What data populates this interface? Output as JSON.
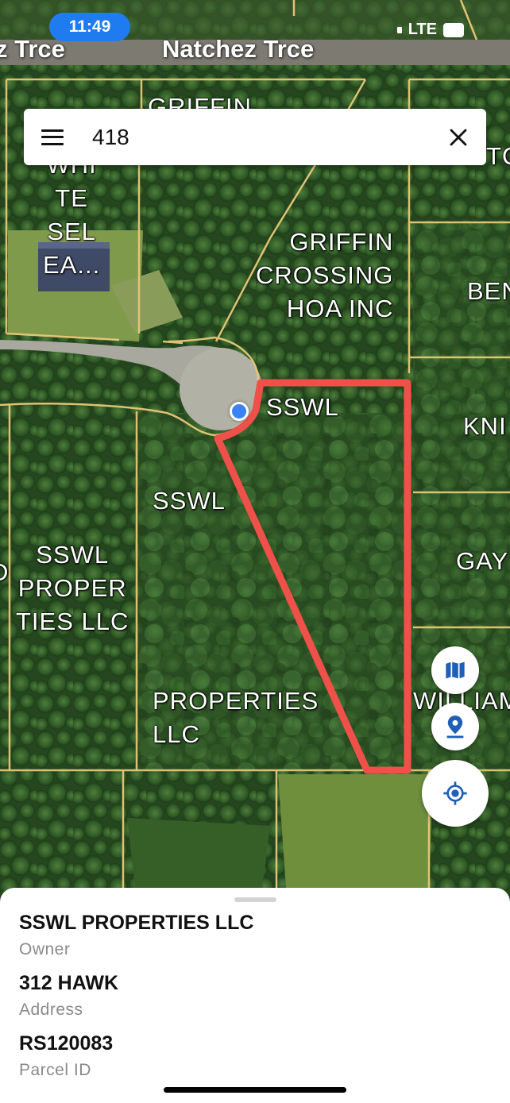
{
  "status_bar": {
    "time": "11:49",
    "network": "LTE"
  },
  "map": {
    "roads": [
      {
        "id": "natchez-left",
        "label": "z Trce"
      },
      {
        "id": "natchez-main",
        "label": "Natchez Trce"
      }
    ],
    "parcel_labels": [
      {
        "id": "griffin-hoa-top",
        "text": "GRIFFIN\nHOA INC"
      },
      {
        "id": "white-sel",
        "text": "WHI\nTE\nSEL\nEA..."
      },
      {
        "id": "griffin-crossing",
        "text": "GRIFFIN\nCROSSING\nHOA INC"
      },
      {
        "id": "tc-edge",
        "text": "TC"
      },
      {
        "id": "ben-edge",
        "text": "BEN"
      },
      {
        "id": "sswl-selected",
        "text": "SSWL"
      },
      {
        "id": "kni-edge",
        "text": "KNI"
      },
      {
        "id": "sswl-middle",
        "text": "SSWL"
      },
      {
        "id": "sswl-properties-left",
        "text": "SSWL\nPROPER\nTIES LLC"
      },
      {
        "id": "gay-edge",
        "text": "GAY"
      },
      {
        "id": "properties-llc",
        "text": "PROPERTIES\nLLC"
      },
      {
        "id": "william-edge",
        "text": "WILLIAM"
      },
      {
        "id": "d-edge",
        "text": "D"
      }
    ],
    "selected_parcel_color": "#f0504a",
    "parcel_line_color": "#e8c878",
    "location_dot_color": "#3b82f6"
  },
  "search": {
    "value": "418"
  },
  "controls": [
    {
      "id": "map-layers",
      "icon": "map-icon"
    },
    {
      "id": "drop-pin",
      "icon": "location-pin-icon"
    },
    {
      "id": "my-location",
      "icon": "crosshair-location-icon"
    }
  ],
  "parcel_info": {
    "owner": {
      "value": "SSWL PROPERTIES LLC",
      "label": "Owner"
    },
    "address": {
      "value": "312 HAWK",
      "label": "Address"
    },
    "parcel_id": {
      "value": "RS120083",
      "label": "Parcel ID"
    }
  }
}
